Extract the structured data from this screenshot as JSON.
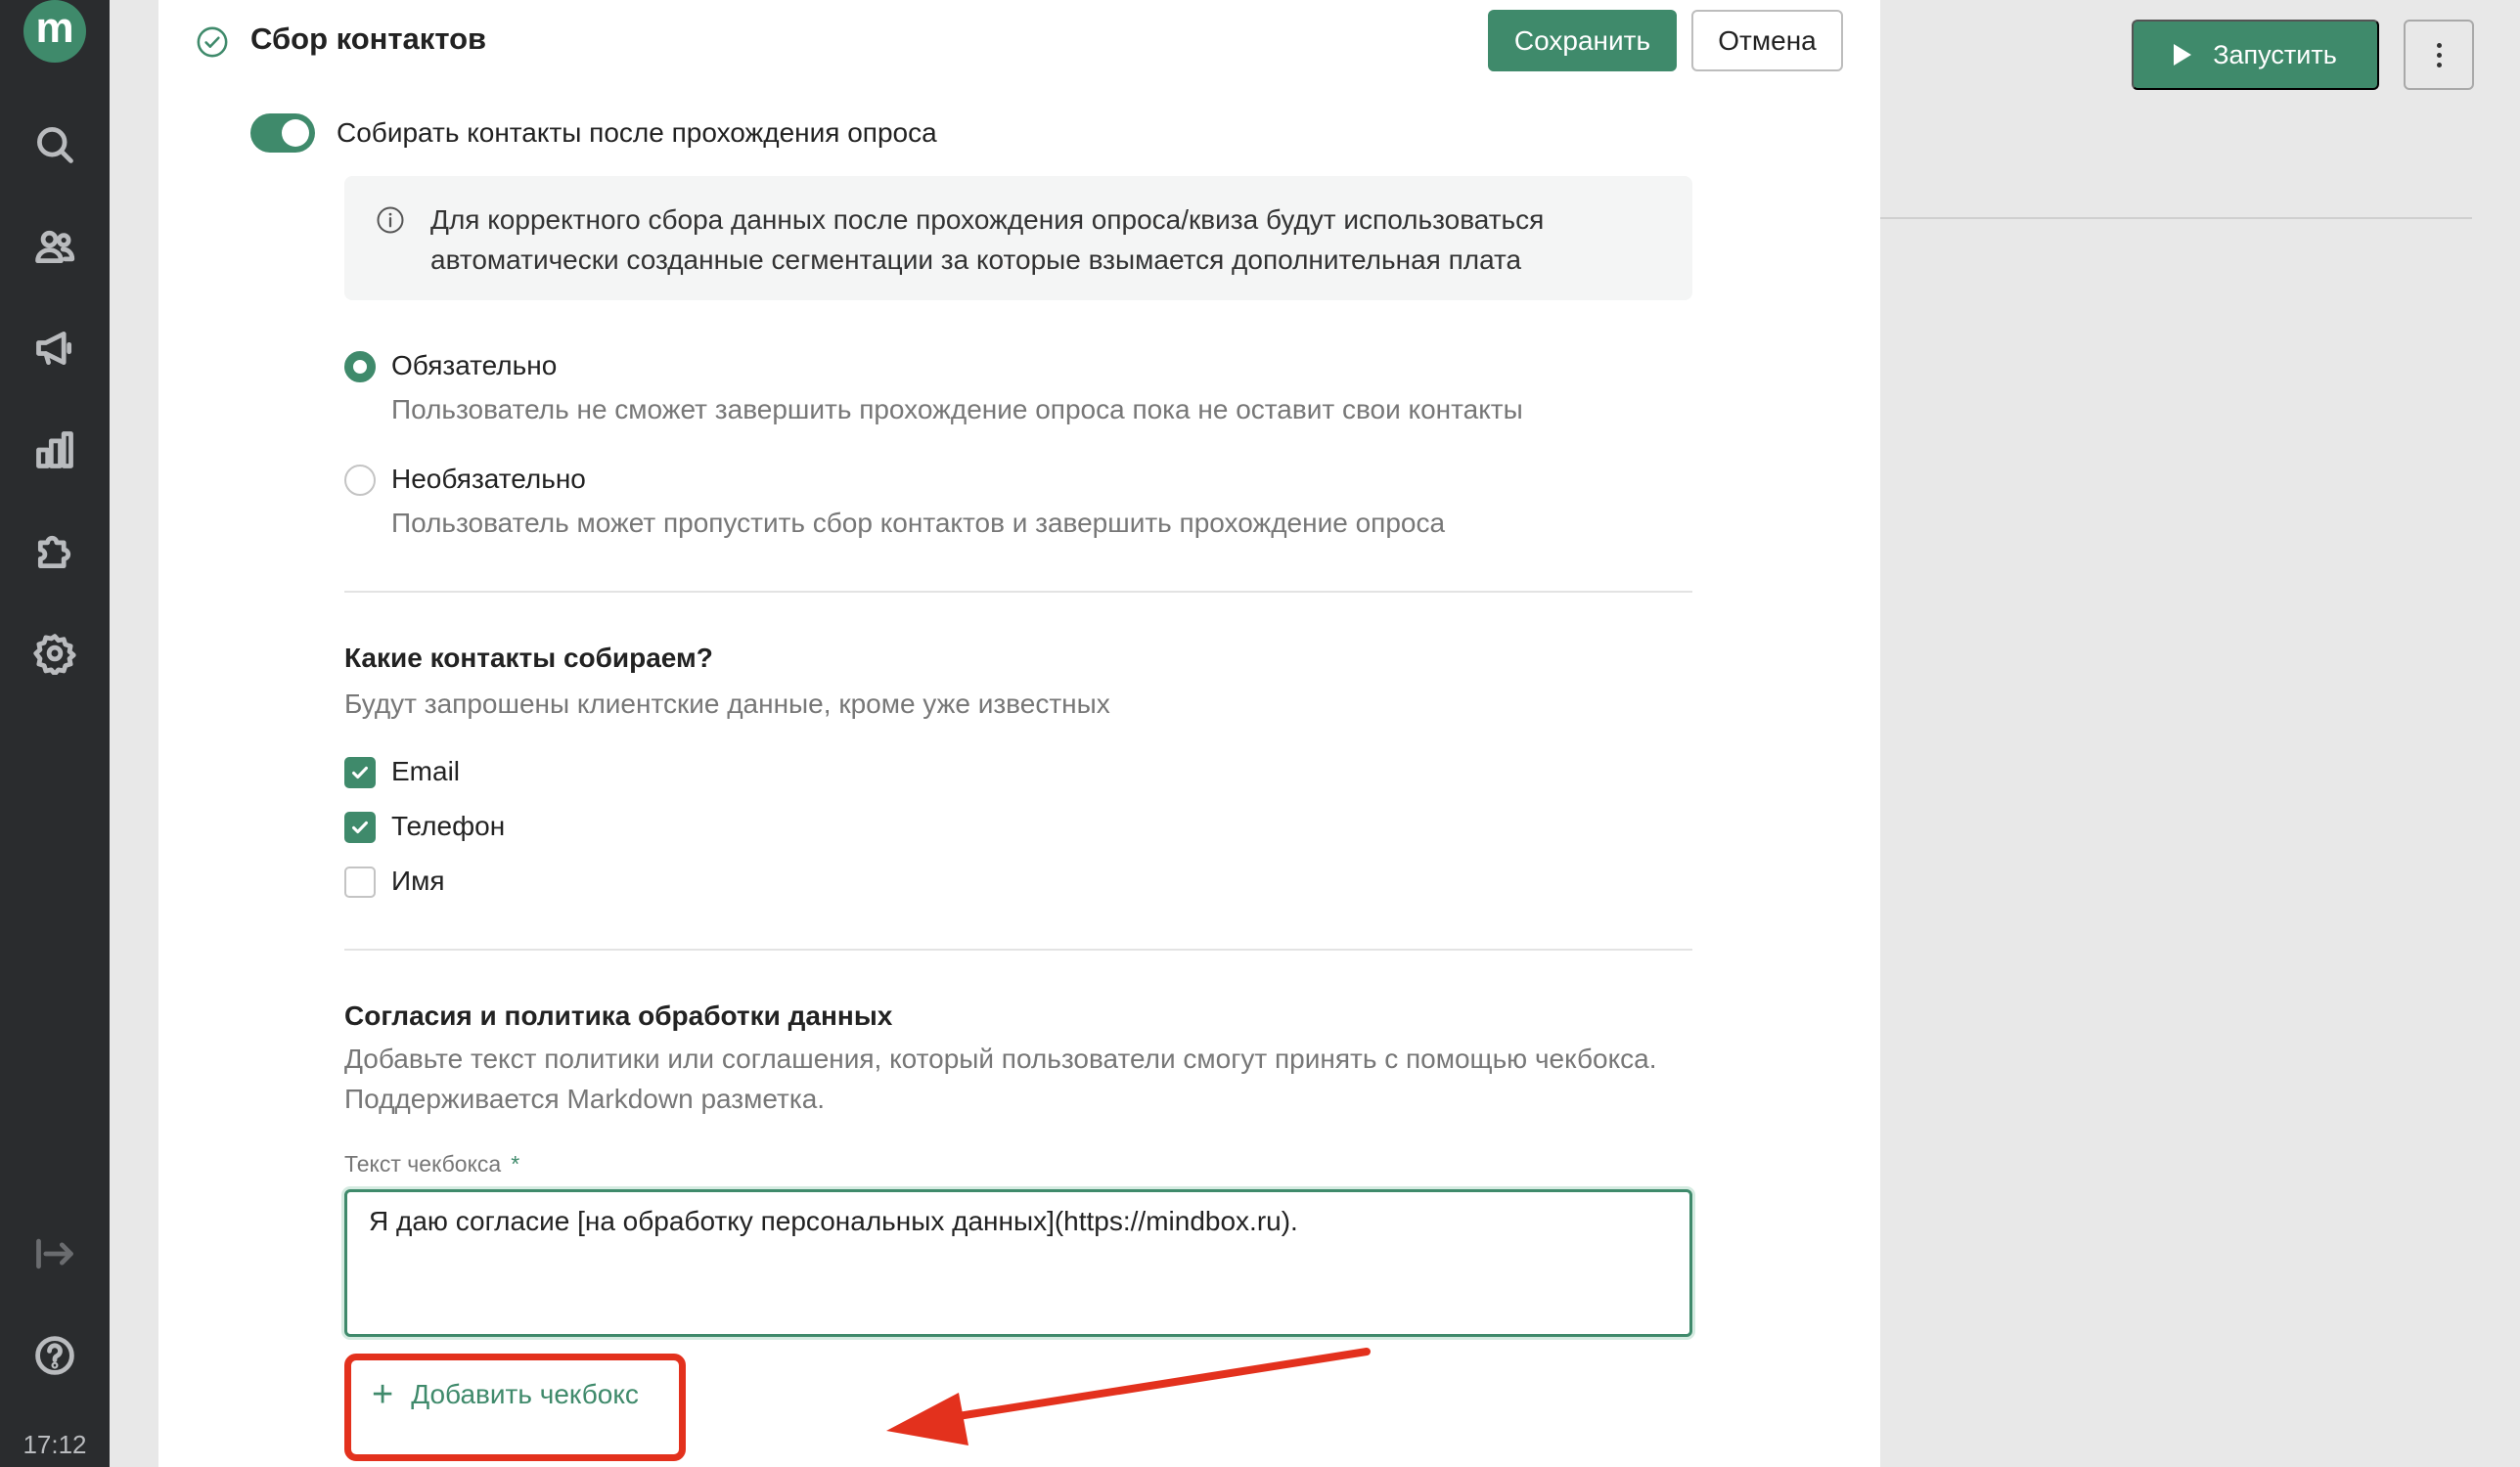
{
  "sidebar": {
    "logo_letter": "m",
    "icons": [
      "search-icon",
      "users-icon",
      "megaphone-icon",
      "chart-icon",
      "puzzle-icon",
      "gear-icon",
      "logout-icon",
      "help-icon"
    ],
    "clock": "17:12"
  },
  "background": {
    "launch_label": "Запустить"
  },
  "modal": {
    "title": "Сбор контактов",
    "save_label": "Сохранить",
    "cancel_label": "Отмена",
    "toggle_label": "Собирать контакты после прохождения опроса",
    "toggle_on": true,
    "info_text": "Для корректного сбора данных после прохождения опроса/квиза будут использоваться автоматически созданные сегментации за которые взымается дополнительная плата",
    "options": [
      {
        "title": "Обязательно",
        "desc": "Пользователь не сможет завершить прохождение опроса пока не оставит свои контакты",
        "selected": true
      },
      {
        "title": "Необязательно",
        "desc": "Пользователь может пропустить сбор контактов и завершить прохождение опроса",
        "selected": false
      }
    ],
    "contacts_section": {
      "title": "Какие контакты собираем?",
      "desc": "Будут запрошены клиентские данные, кроме уже известных",
      "items": [
        {
          "label": "Email",
          "checked": true
        },
        {
          "label": "Телефон",
          "checked": true
        },
        {
          "label": "Имя",
          "checked": false
        }
      ]
    },
    "consent_section": {
      "title": "Согласия и политика обработки данных",
      "desc": "Добавьте текст политики или соглашения, который пользователи смогут принять с помощью чекбокса. Поддерживается Markdown разметка.",
      "field_label": "Текст чекбокса",
      "required_mark": "*",
      "field_value": "Я даю согласие [на обработку персональных данных](https://mindbox.ru).",
      "add_label": "Добавить чекбокс"
    }
  },
  "colors": {
    "accent": "#3f8a6b",
    "annotation": "#e3311d",
    "sidebar_bg": "#2a2c2e"
  }
}
